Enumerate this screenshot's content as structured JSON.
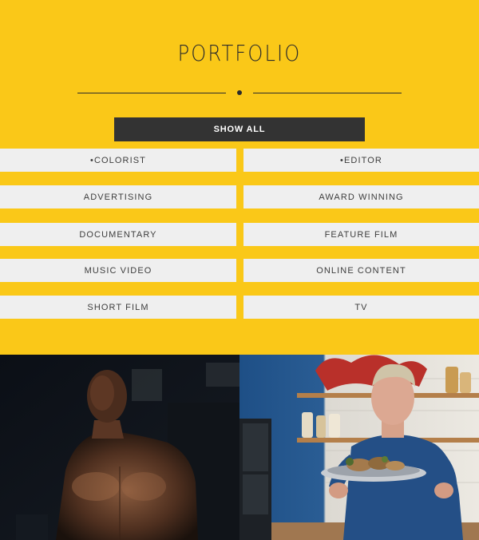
{
  "portfolio": {
    "title": "PORTFOLIO",
    "show_all_label": "SHOW ALL"
  },
  "filters": [
    "•COLORIST",
    "•EDITOR",
    "ADVERTISING",
    "AWARD WINNING",
    "DOCUMENTARY",
    "FEATURE FILM",
    "MUSIC VIDEO",
    "ONLINE CONTENT",
    "SHORT FILM",
    "TV"
  ],
  "thumbnails": [
    {
      "name": "boxer-portrait-thumbnail"
    },
    {
      "name": "chef-kitchen-thumbnail"
    }
  ],
  "colors": {
    "background": "#fac818",
    "button_dark": "#333333",
    "filter_bg": "#efefef"
  }
}
